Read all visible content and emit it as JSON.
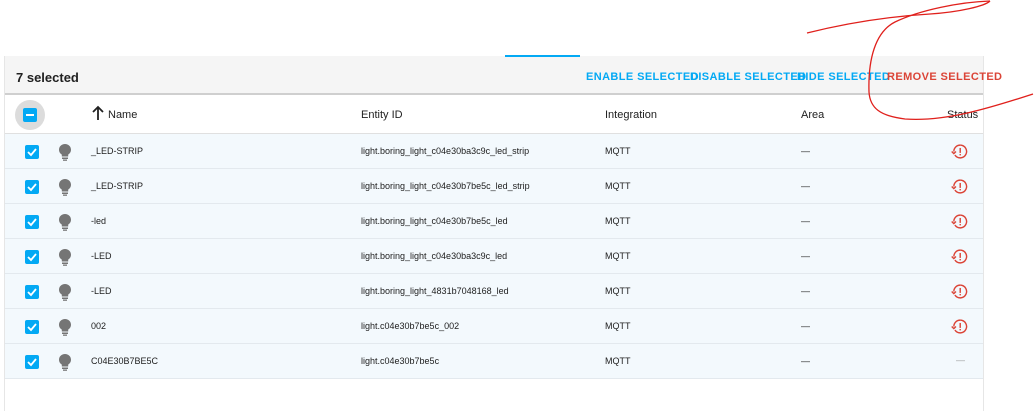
{
  "toolbar": {
    "selected_count": "7 selected",
    "enable_label": "ENABLE SELECTED",
    "disable_label": "DISABLE SELECTED",
    "hide_label": "HIDE SELECTED",
    "remove_label": "REMOVE SELECTED"
  },
  "table": {
    "columns": {
      "name": "Name",
      "entity_id": "Entity ID",
      "integration": "Integration",
      "area": "Area",
      "status": "Status"
    },
    "rows": [
      {
        "name": "_LED-STRIP",
        "entity_id": "light.boring_light_c04e30ba3c9c_led_strip",
        "integration": "MQTT",
        "area": "—",
        "status": "unavailable",
        "selected": true
      },
      {
        "name": "_LED-STRIP",
        "entity_id": "light.boring_light_c04e30b7be5c_led_strip",
        "integration": "MQTT",
        "area": "—",
        "status": "unavailable",
        "selected": true
      },
      {
        "name": "-led",
        "entity_id": "light.boring_light_c04e30b7be5c_led",
        "integration": "MQTT",
        "area": "—",
        "status": "unavailable",
        "selected": true
      },
      {
        "name": "-LED",
        "entity_id": "light.boring_light_c04e30ba3c9c_led",
        "integration": "MQTT",
        "area": "—",
        "status": "unavailable",
        "selected": true
      },
      {
        "name": "-LED",
        "entity_id": "light.boring_light_4831b7048168_led",
        "integration": "MQTT",
        "area": "—",
        "status": "unavailable",
        "selected": true
      },
      {
        "name": "002",
        "entity_id": "light.c04e30b7be5c_002",
        "integration": "MQTT",
        "area": "—",
        "status": "unavailable",
        "selected": true
      },
      {
        "name": "C04E30B7BE5C",
        "entity_id": "light.c04e30b7be5c",
        "integration": "MQTT",
        "area": "—",
        "status_text": "—",
        "status": "none",
        "selected": true
      }
    ]
  },
  "icons": {
    "row_icon": "lightbulb-icon",
    "status_icon": "restore-alert-icon",
    "sort_icon": "arrow-up-icon"
  },
  "colors": {
    "accent": "#03a9f4",
    "danger": "#db4437",
    "annotation": "#e0201c"
  }
}
